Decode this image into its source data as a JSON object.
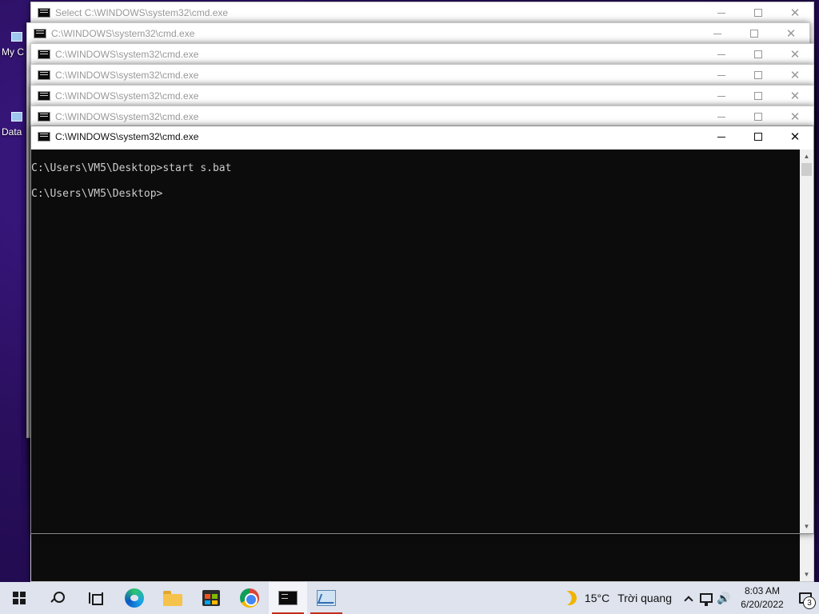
{
  "desktop": {
    "icons": [
      {
        "label": "My C"
      },
      {
        "label": "Data"
      }
    ]
  },
  "windows": [
    {
      "title": "Select C:\\WINDOWS\\system32\\cmd.exe"
    },
    {
      "title": "C:\\WINDOWS\\system32\\cmd.exe"
    },
    {
      "title": "C:\\WINDOWS\\system32\\cmd.exe"
    },
    {
      "title": "C:\\WINDOWS\\system32\\cmd.exe"
    },
    {
      "title": "C:\\WINDOWS\\system32\\cmd.exe"
    },
    {
      "title": "C:\\WINDOWS\\system32\\cmd.exe"
    },
    {
      "title": "C:\\WINDOWS\\system32\\cmd.exe"
    }
  ],
  "controls": {
    "close": "✕"
  },
  "console": {
    "lines": [
      "C:\\Users\\VM5\\Desktop>start s.bat",
      "C:\\Users\\VM5\\Desktop>"
    ]
  },
  "scrollbar": {
    "up": "▲",
    "down": "▼"
  },
  "taskbar": {
    "apps": [
      "start-icon",
      "search-icon",
      "task-view-icon",
      "edge-icon",
      "file-explorer-icon",
      "store-icon",
      "chrome-icon",
      "cmd-icon",
      "performance-monitor-icon"
    ],
    "weather": {
      "temperature": "15°C",
      "condition": "Trời quang"
    },
    "volume_glyph": "🔊",
    "clock": {
      "time": "8:03 AM",
      "date": "6/20/2022"
    },
    "notifications": {
      "count": "3"
    }
  },
  "colors": {
    "console_bg": "#0c0c0c",
    "console_fg": "#cccccc",
    "taskbar_bg": "#dfe3ee",
    "running_indicator": "#c42b1c"
  }
}
